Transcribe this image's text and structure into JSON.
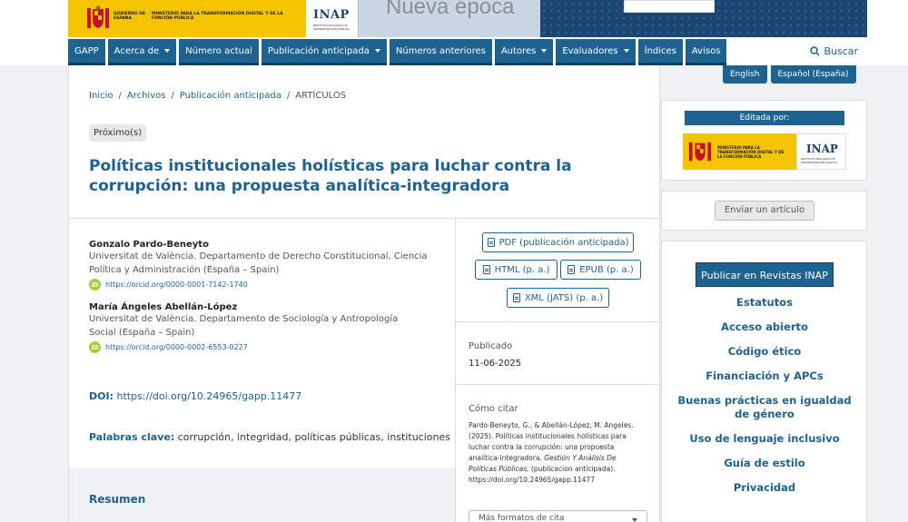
{
  "header": {
    "gov_text": "GOBIERNO DE ESPAÑA",
    "ministry_text": "MINISTERIO PARA LA TRANSFORMACIÓN DIGITAL Y DE LA FUNCIÓN PÚBLICA",
    "inap_logo": "INAP",
    "inap_sub": "INSTITUTO NACIONAL DE ADMINISTRACIÓN PÚBLICA",
    "journal_title": "Nueva época"
  },
  "nav": {
    "items": [
      {
        "label": "GAPP",
        "dropdown": false
      },
      {
        "label": "Acerca de",
        "dropdown": true
      },
      {
        "label": "Número actual",
        "dropdown": false
      },
      {
        "label": "Publicación anticipada",
        "dropdown": true
      },
      {
        "label": "Números anteriores",
        "dropdown": false
      },
      {
        "label": "Autores",
        "dropdown": true
      },
      {
        "label": "Evaluadores",
        "dropdown": true
      },
      {
        "label": "Índices",
        "dropdown": false
      },
      {
        "label": "Avisos",
        "dropdown": false
      }
    ],
    "search_label": "Buscar"
  },
  "breadcrumb": {
    "items": [
      "Inicio",
      "Archivos",
      "Publicación anticipada"
    ],
    "current": "ARTÍCULOS"
  },
  "article": {
    "badge": "Próximo(s)",
    "title": "Políticas institucionales holísticas para luchar contra la corrupción: una propuesta analítica-integradora",
    "authors": [
      {
        "name": "Gonzalo Pardo-Beneyto",
        "affiliation": "Universitat de València. Departamento de Derecho Constitucional, Ciencia Política y Administración (España – Spain)",
        "orcid": "https://orcid.org/0000-0001-7142-1740"
      },
      {
        "name": "María Ángeles Abellán-López",
        "affiliation": "Universitat de València. Departamento de Sociología y Antropología Social (España – Spain)",
        "orcid": "https://orcid.org/0000-0002-6553-0227"
      }
    ],
    "doi_label": "DOI:",
    "doi_value": "https://doi.org/10.24965/gapp.11477",
    "keywords_label": "Palabras clave:",
    "keywords_value": "corrupción, integridad, políticas públicas, instituciones",
    "resumen_label": "Resumen"
  },
  "galleys": {
    "pdf": "PDF (publicación anticipada)",
    "html": "HTML (p. a.)",
    "epub": "EPUB (p. a.)",
    "xml": "XML (JATS) (p. a.)"
  },
  "published": {
    "label": "Publicado",
    "date": "11-06-2025"
  },
  "citation": {
    "label": "Cómo citar",
    "text_plain": "Pardo-Beneyto, G., & Abellán-López, M. Ángeles. (2025). Políticas institucionales holísticas para luchar contra la corrupción: una propuesta analítica-integradora.",
    "journal": "Gestión Y Análisis De Políticas Públicas,",
    "text_tail": "(publicacion anticipada). https://doi.org/10.24965/gapp.11477",
    "formats_select": "Más formatos de cita"
  },
  "sidebar": {
    "languages": [
      "English",
      "Español (España)"
    ],
    "edited_by": "Editada por:",
    "sponsor_text": "MINISTERIO PARA LA TRANSFORMACIÓN DIGITAL Y DE LA FUNCIÓN PÚBLICA",
    "sponsor_inap": "INAP",
    "sponsor_inap_sub": "INSTITUTO NACIONAL DE ADMINISTRACIÓN PÚBLICA",
    "submit_button": "Enviar un artículo",
    "publish_button": "Publicar en Revistas INAP",
    "links": [
      "Estatutos",
      "Acceso abierto",
      "Código ético",
      "Financiación y APCs",
      "Buenas prácticas en igualdad de género",
      "Uso de lenguaje inclusivo",
      "Guía de estilo",
      "Privacidad"
    ]
  },
  "colors": {
    "primary": "#1e6292",
    "accent_yellow": "#f5c400",
    "orcid_green": "#a6ce39"
  }
}
